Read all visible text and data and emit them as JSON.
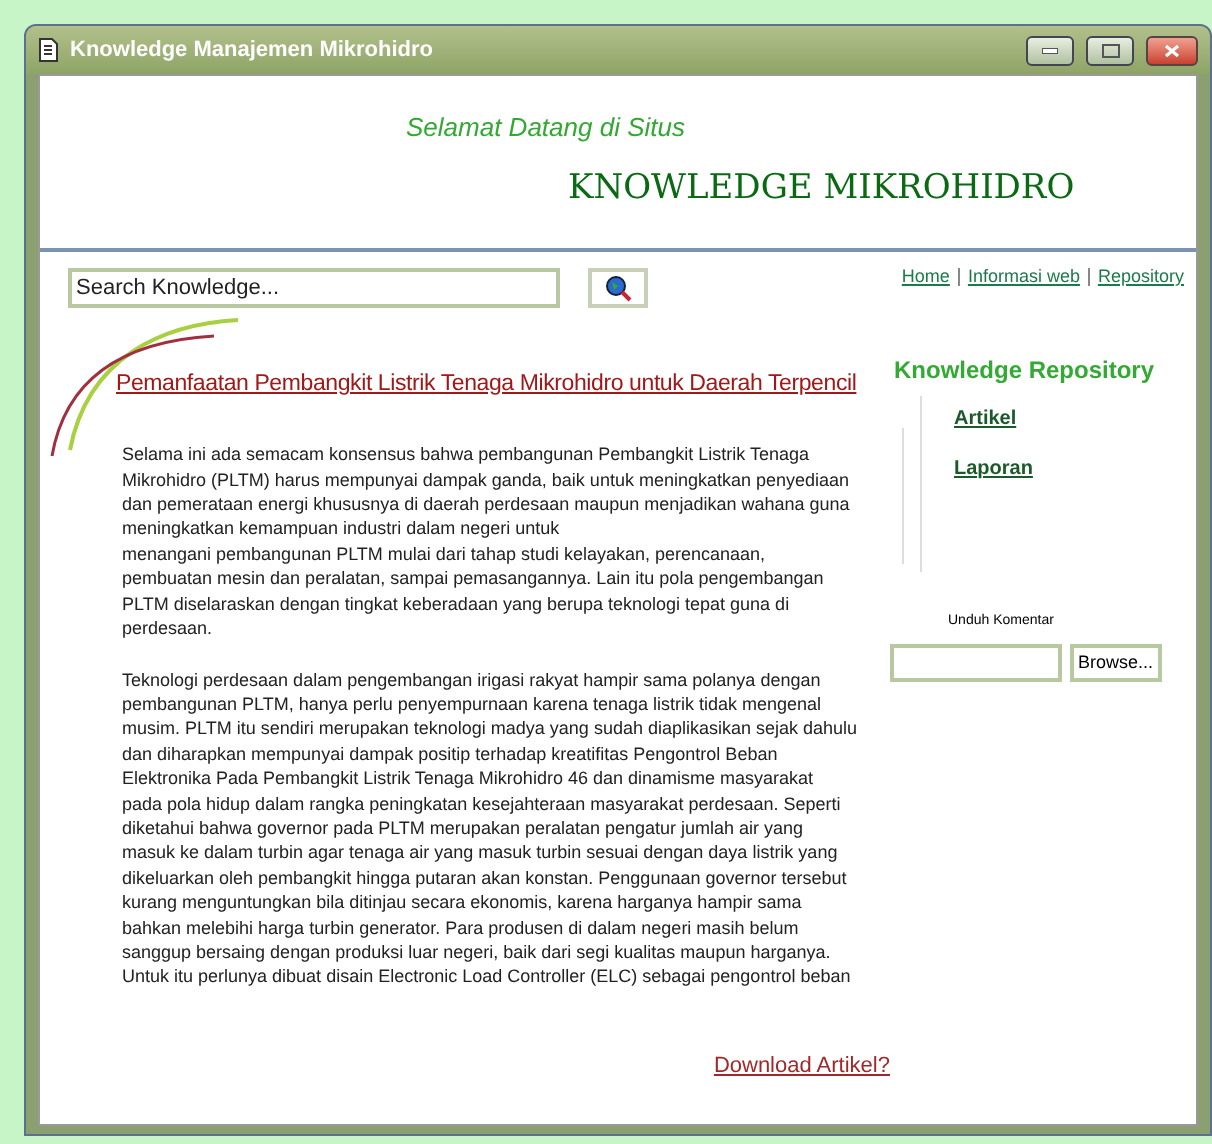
{
  "window": {
    "title": "Knowledge Manajemen Mikrohidro"
  },
  "header": {
    "greeting": "Selamat Datang di Situs",
    "site_title": "KNOWLEDGE MIKROHIDRO"
  },
  "search": {
    "placeholder": "Search Knowledge..."
  },
  "nav_links": [
    "Home",
    "Informasi web",
    "Repository"
  ],
  "article": {
    "title": "Pemanfaatan Pembangkit Listrik Tenaga Mikrohidro untuk Daerah Terpencil",
    "paragraphs": [
      "Selama ini ada semacam konsensus bahwa pembangunan Pembangkit Listrik Tenaga Mikrohidro (PLTM) harus mempunyai dampak ganda, baik untuk meningkatkan penyediaan dan pemerataan energi khususnya di daerah perdesaan maupun menjadikan wahana guna meningkatkan kemampuan industri dalam negeri untuk\nmenangani pembangunan PLTM mulai dari tahap studi kelayakan, perencanaan, pembuatan mesin dan peralatan, sampai pemasangannya. Lain itu pola pengembangan PLTM diselaraskan dengan tingkat keberadaan yang berupa teknologi tepat guna di perdesaan.",
      "Teknologi perdesaan dalam pengembangan irigasi rakyat hampir sama polanya dengan pembangunan PLTM, hanya perlu penyempurnaan karena tenaga listrik tidak mengenal musim. PLTM itu sendiri merupakan teknologi madya yang sudah diaplikasikan sejak dahulu dan diharapkan mempunyai dampak positip terhadap kreatifitas Pengontrol Beban Elektronika Pada Pembangkit Listrik Tenaga Mikrohidro 46 dan dinamisme masyarakat pada pola hidup dalam rangka peningkatan kesejahteraan masyarakat perdesaan. Seperti diketahui bahwa governor pada PLTM merupakan peralatan pengatur jumlah air yang masuk ke dalam turbin agar tenaga air yang masuk turbin sesuai dengan daya listrik yang dikeluarkan oleh pembangkit hingga putaran akan konstan. Penggunaan governor tersebut kurang menguntungkan bila ditinjau secara ekonomis, karena harganya hampir sama bahkan melebihi harga turbin generator. Para produsen di dalam negeri masih belum sanggup bersaing dengan produksi luar negeri, baik dari segi kualitas maupun harganya. Untuk itu perlunya dibuat disain Electronic Load Controller (ELC) sebagai pengontrol beban"
    ],
    "download_link": "Download Artikel?"
  },
  "repository": {
    "title": "Knowledge Repository",
    "links": [
      "Artikel",
      "Laporan"
    ]
  },
  "upload": {
    "label": "Unduh Komentar",
    "browse_button": "Browse..."
  }
}
